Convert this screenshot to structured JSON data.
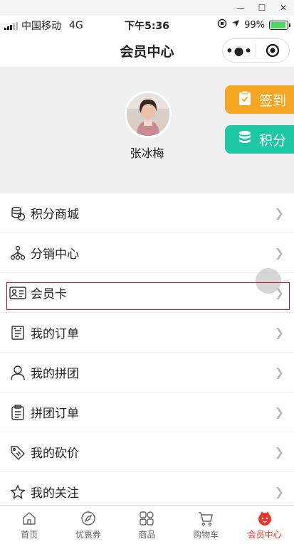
{
  "status_bar": {
    "carrier": "中国移动",
    "network": "4G",
    "time": "下午5:36",
    "battery": "99%"
  },
  "navbar": {
    "title": "会员中心"
  },
  "profile": {
    "username": "张冰梅"
  },
  "actions": {
    "signin_label": "签到",
    "points_label": "积分"
  },
  "menu": {
    "items": [
      {
        "label": "积分商城",
        "icon": "coin-stack-icon"
      },
      {
        "label": "分销中心",
        "icon": "network-icon"
      },
      {
        "label": "会员卡",
        "icon": "member-card-icon"
      },
      {
        "label": "我的订单",
        "icon": "order-list-icon"
      },
      {
        "label": "我的拼团",
        "icon": "user-icon"
      },
      {
        "label": "拼团订单",
        "icon": "clipboard-icon"
      },
      {
        "label": "我的砍价",
        "icon": "price-tag-icon"
      },
      {
        "label": "我的关注",
        "icon": "star-icon"
      }
    ]
  },
  "tabbar": {
    "items": [
      {
        "label": "首页",
        "icon": "home-icon"
      },
      {
        "label": "优惠券",
        "icon": "compass-icon"
      },
      {
        "label": "商品",
        "icon": "grid-icon"
      },
      {
        "label": "购物车",
        "icon": "cart-icon"
      },
      {
        "label": "会员中心",
        "icon": "member-face-icon",
        "active": true
      }
    ]
  },
  "colors": {
    "accent": "#e8342b",
    "signin": "#f5a623",
    "points": "#1ec8a5",
    "highlight_border": "#d0021b"
  }
}
